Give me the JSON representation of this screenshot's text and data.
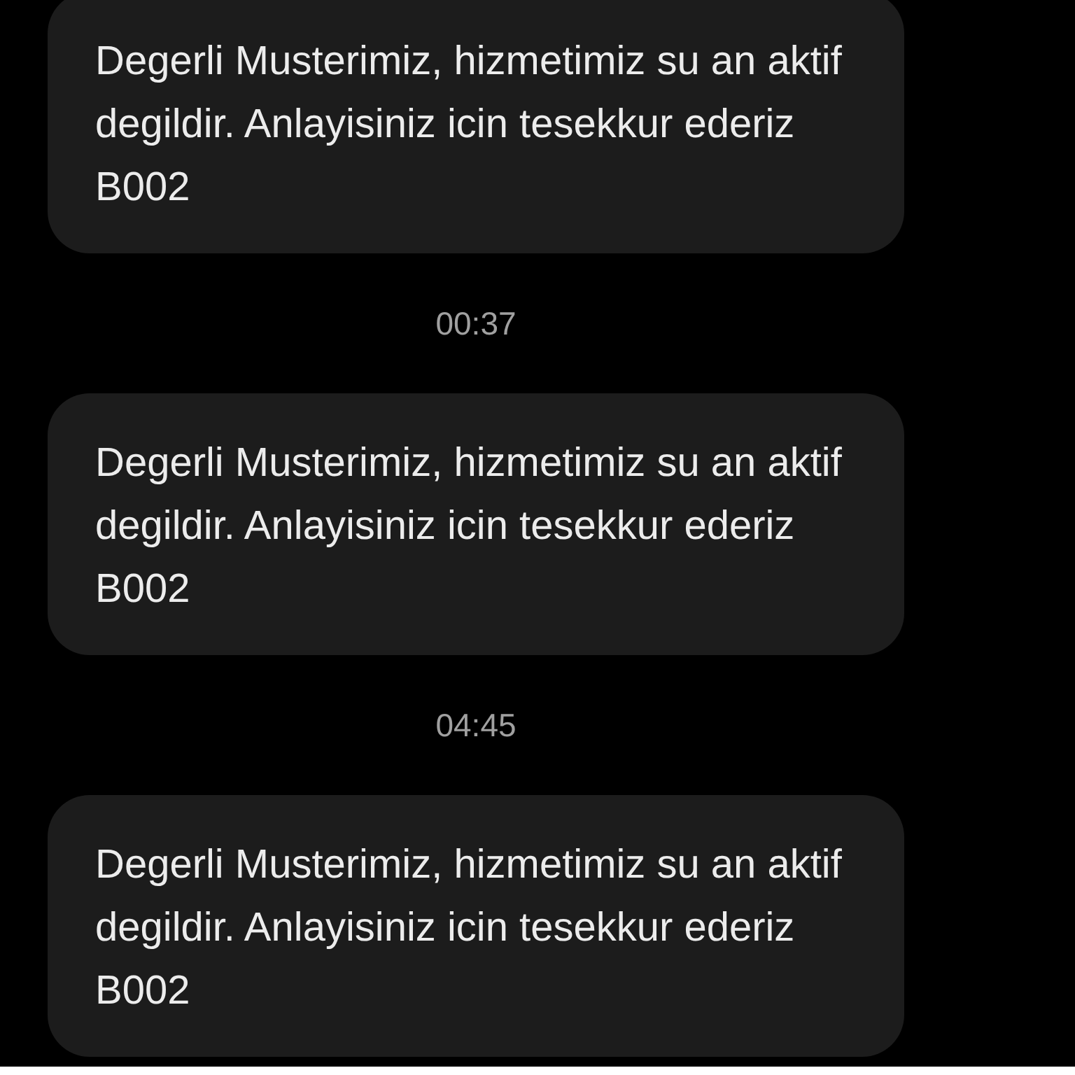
{
  "items": [
    {
      "kind": "message",
      "text": "Degerli Musterimiz, hizmetimiz su an aktif degildir. Anlayisiniz icin tesekkur ederiz B002"
    },
    {
      "kind": "timestamp",
      "text": "00:37"
    },
    {
      "kind": "message",
      "text": "Degerli Musterimiz, hizmetimiz su an aktif degildir. Anlayisiniz icin tesekkur ederiz B002"
    },
    {
      "kind": "timestamp",
      "text": "04:45"
    },
    {
      "kind": "message",
      "text": "Degerli Musterimiz, hizmetimiz su an aktif degildir. Anlayisiniz icin tesekkur ederiz B002"
    }
  ]
}
